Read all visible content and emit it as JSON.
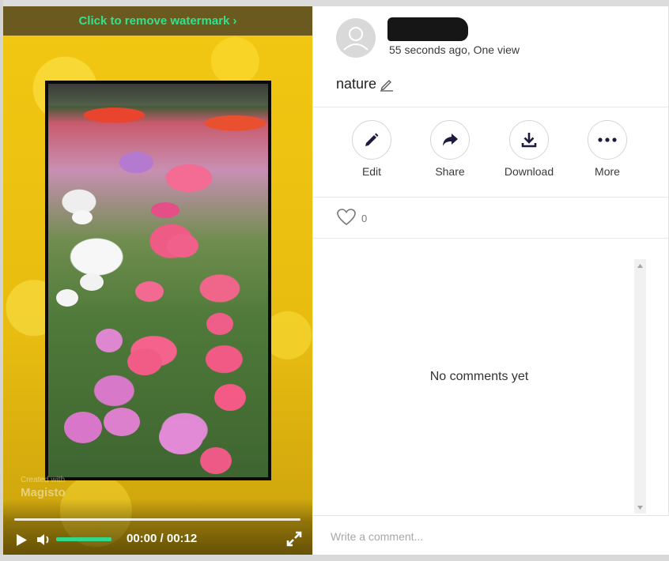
{
  "player": {
    "watermark_link": "Click to remove watermark ›",
    "brand_small": "Created with",
    "brand_big": "Magisto",
    "time": "00:00 / 00:12",
    "progress": 0,
    "volume": 1.0,
    "accent_color": "#31d88a",
    "icons": [
      "play-icon",
      "volume-icon",
      "fullscreen-icon"
    ]
  },
  "post": {
    "author_name": "",
    "meta": "55 seconds ago, One view",
    "title": "nature"
  },
  "actions": [
    {
      "label": "Edit",
      "icon": "pencil-icon"
    },
    {
      "label": "Share",
      "icon": "share-arrow-icon"
    },
    {
      "label": "Download",
      "icon": "download-icon"
    },
    {
      "label": "More",
      "icon": "more-dots-icon"
    }
  ],
  "likes": {
    "count": "0",
    "icon": "heart-icon"
  },
  "comments": {
    "empty_text": "No comments yet",
    "placeholder": "Write a comment..."
  },
  "colors": {
    "icon_dark": "#1d1a40",
    "video_background": "#ebbe10",
    "watermark_text": "#36e08a"
  }
}
